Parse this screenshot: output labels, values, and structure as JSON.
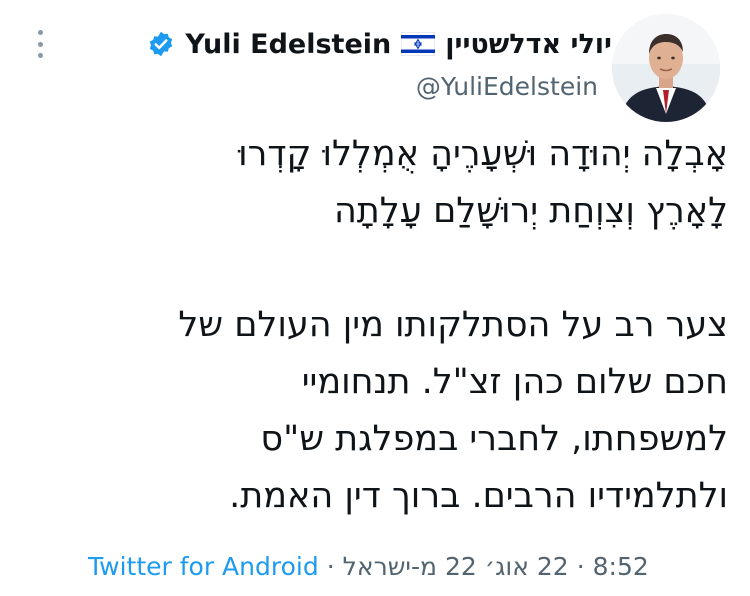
{
  "header": {
    "display_name_en": "Yuli Edelstein",
    "display_name_he": "יולי אדלשטיין",
    "handle": "@YuliEdelstein",
    "flag_icon": "israel-flag-icon",
    "verified_icon": "verified-badge-icon",
    "more_icon": "more-options-icon"
  },
  "tweet": {
    "lines": [
      "אָבְלָה יְהוּדָה וּשְׁעָרֶיהָ אֻמְלְלוּ קָדְרוּ",
      "לָאָרֶץ וְצִוְחַת יְרוּשָׁלִַם עָלָתָה",
      "צער רב על הסתלקותו מין העולם של",
      "חכם שלום כהן זצ\"ל. תנחומיי",
      "למשפחתו, לחברי במפלגת ש\"ס",
      "ולתלמידיו הרבים. ברוך דין האמת."
    ]
  },
  "footer": {
    "time": "8:52",
    "separator": "·",
    "date_location": "22 אוג׳ 22 מ-ישראל",
    "source": "Twitter for Android"
  },
  "colors": {
    "text": "#0f1419",
    "secondary": "#536471",
    "link": "#1d9bf0",
    "verified": "#1d9bf0"
  }
}
